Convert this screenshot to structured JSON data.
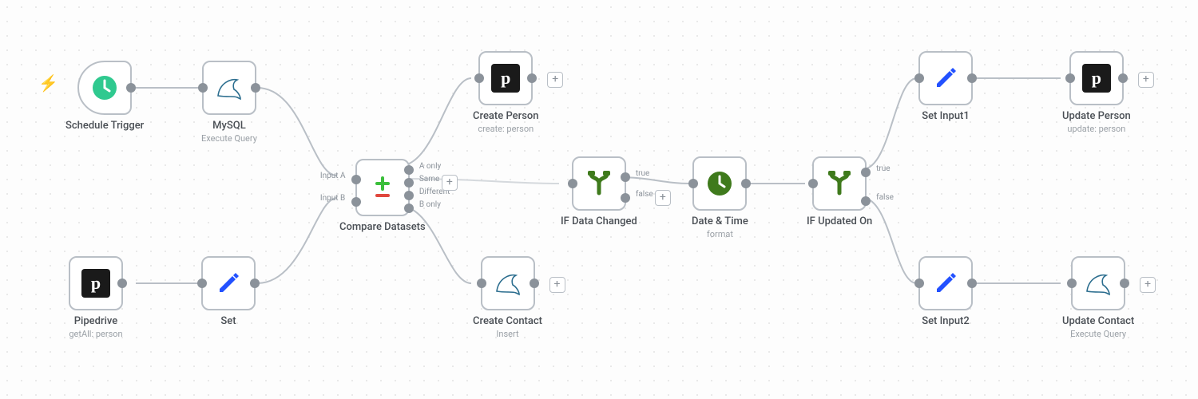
{
  "nodes": {
    "schedule_trigger": {
      "title": "Schedule Trigger",
      "sub": ""
    },
    "mysql": {
      "title": "MySQL",
      "sub": "Execute Query"
    },
    "pipedrive": {
      "title": "Pipedrive",
      "sub": "getAll: person"
    },
    "set": {
      "title": "Set",
      "sub": ""
    },
    "compare": {
      "title": "Compare Datasets",
      "sub": "",
      "in_labels": [
        "Input A",
        "Input B"
      ],
      "out_labels": [
        "A only",
        "Same",
        "Different",
        "B only"
      ]
    },
    "create_person": {
      "title": "Create Person",
      "sub": "create: person"
    },
    "if_data_changed": {
      "title": "IF Data Changed",
      "sub": "",
      "out_labels": [
        "true",
        "false"
      ]
    },
    "date_time": {
      "title": "Date & Time",
      "sub": "format"
    },
    "if_updated_on": {
      "title": "IF Updated On",
      "sub": "",
      "out_labels": [
        "true",
        "false"
      ]
    },
    "create_contact": {
      "title": "Create Contact",
      "sub": "Insert"
    },
    "set_input1": {
      "title": "Set Input1",
      "sub": ""
    },
    "set_input2": {
      "title": "Set Input2",
      "sub": ""
    },
    "update_person": {
      "title": "Update Person",
      "sub": "update: person"
    },
    "update_contact": {
      "title": "Update Contact",
      "sub": "Execute Query"
    }
  }
}
